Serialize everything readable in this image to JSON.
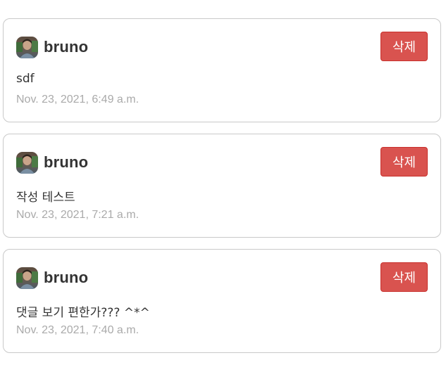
{
  "comments": [
    {
      "author": "bruno",
      "body": "sdf",
      "timestamp": "Nov. 23, 2021, 6:49 a.m.",
      "delete_label": "삭제"
    },
    {
      "author": "bruno",
      "body": "작성 테스트",
      "timestamp": "Nov. 23, 2021, 7:21 a.m.",
      "delete_label": "삭제"
    },
    {
      "author": "bruno",
      "body": "댓글 보기 편한가??? ^*^",
      "timestamp": "Nov. 23, 2021, 7:40 a.m.",
      "delete_label": "삭제"
    }
  ],
  "colors": {
    "delete_button": "#d9534f",
    "card_border": "#c9c9c9",
    "timestamp_text": "#aaaaaa",
    "body_text": "#333333"
  },
  "icons": {
    "avatar": "user-avatar-photo"
  }
}
